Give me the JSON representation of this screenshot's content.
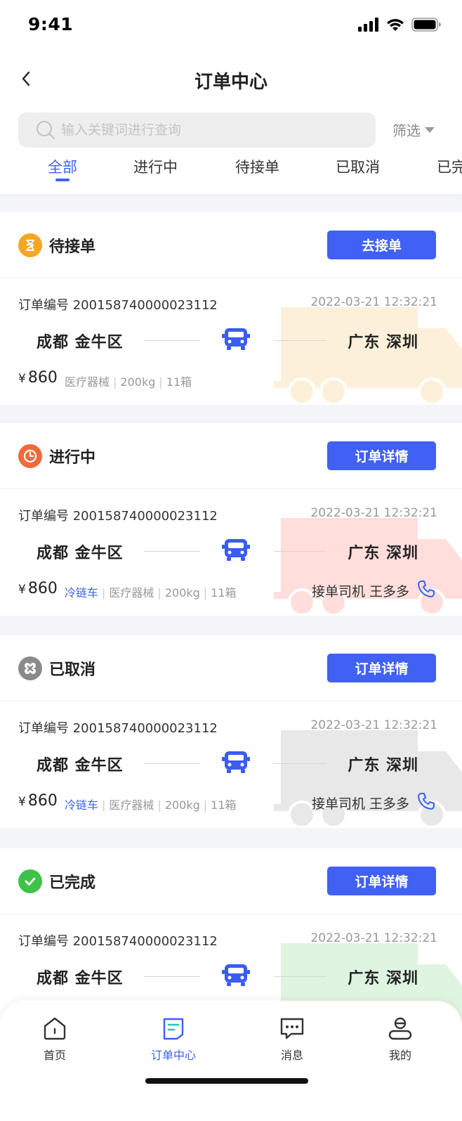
{
  "status_bar": {
    "time": "9:41"
  },
  "nav": {
    "title": "订单中心"
  },
  "search": {
    "placeholder": "输入关键词进行查询",
    "filter_label": "筛选"
  },
  "tabs": [
    {
      "label": "全部"
    },
    {
      "label": "进行中"
    },
    {
      "label": "待接单"
    },
    {
      "label": "已取消"
    },
    {
      "label": "已完成"
    }
  ],
  "orders": [
    {
      "status": "待接单",
      "status_color": "#f5a623",
      "action_label": "去接单",
      "order_no": "订单编号 200158740000023112",
      "time": "2022-03-21 12:32:21",
      "from": "成都 金牛区",
      "to": "广东 深圳",
      "currency": "¥",
      "price": "860",
      "vehicle": "",
      "cargo": "医疗器械",
      "weight": "200kg",
      "count": "11箱",
      "driver": "",
      "truck_color": "#f5a623"
    },
    {
      "status": "进行中",
      "status_color": "#f06a3a",
      "action_label": "订单详情",
      "order_no": "订单编号 200158740000023112",
      "time": "2022-03-21 12:32:21",
      "from": "成都 金牛区",
      "to": "广东 深圳",
      "currency": "¥",
      "price": "860",
      "vehicle": "冷链车",
      "cargo": "医疗器械",
      "weight": "200kg",
      "count": "11箱",
      "driver": "接单司机  王多多",
      "truck_color": "#ff3b2f"
    },
    {
      "status": "已取消",
      "status_color": "#8a8a8a",
      "action_label": "订单详情",
      "order_no": "订单编号 200158740000023112",
      "time": "2022-03-21 12:32:21",
      "from": "成都 金牛区",
      "to": "广东 深圳",
      "currency": "¥",
      "price": "860",
      "vehicle": "冷链车",
      "cargo": "医疗器械",
      "weight": "200kg",
      "count": "11箱",
      "driver": "接单司机  王多多",
      "truck_color": "#777777"
    },
    {
      "status": "已完成",
      "status_color": "#3fc24a",
      "action_label": "订单详情",
      "order_no": "订单编号 200158740000023112",
      "time": "2022-03-21 12:32:21",
      "from": "成都 金牛区",
      "to": "广东 深圳",
      "currency": "",
      "price": "",
      "vehicle": "",
      "cargo": "",
      "weight": "",
      "count": "",
      "driver": "",
      "truck_color": "#3fc24a"
    }
  ],
  "tabbar": [
    {
      "label": "首页",
      "icon": "home-icon"
    },
    {
      "label": "订单中心",
      "icon": "order-icon"
    },
    {
      "label": "消息",
      "icon": "message-icon"
    },
    {
      "label": "我的",
      "icon": "profile-icon"
    }
  ],
  "colors": {
    "accent": "#4160f4",
    "tab_active": "#3a62f0"
  }
}
